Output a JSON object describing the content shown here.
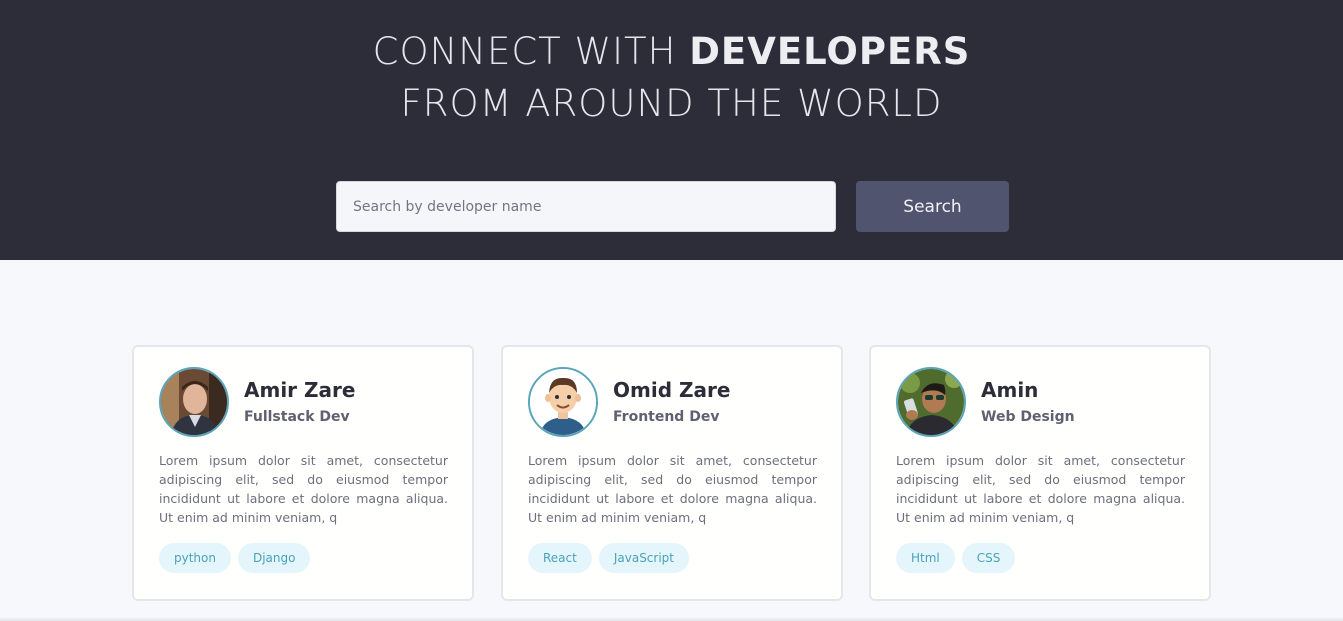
{
  "hero": {
    "title_part1": "CONNECT WITH ",
    "title_bold": "DEVELOPERS",
    "title_line2": "FROM AROUND THE WORLD"
  },
  "search": {
    "placeholder": "Search by developer name",
    "value": "",
    "button_label": "Search"
  },
  "developers": [
    {
      "name": "Amir Zare",
      "role": "Fullstack Dev",
      "avatar_icon": "photo-avatar",
      "bio": "Lorem ipsum dolor sit amet, consectetur adipiscing elit, sed do eiusmod tempor incididunt ut labore et dolore magna aliqua. Ut enim ad minim veniam, q",
      "tags": [
        "python",
        "Django"
      ]
    },
    {
      "name": "Omid Zare",
      "role": "Frontend Dev",
      "avatar_icon": "cartoon-avatar",
      "bio": "Lorem ipsum dolor sit amet, consectetur adipiscing elit, sed do eiusmod tempor incididunt ut labore et dolore magna aliqua. Ut enim ad minim veniam, q",
      "tags": [
        "React",
        "JavaScript"
      ]
    },
    {
      "name": "Amin",
      "role": "Web Design",
      "avatar_icon": "photo-avatar",
      "bio": "Lorem ipsum dolor sit amet, consectetur adipiscing elit, sed do eiusmod tempor incididunt ut labore et dolore magna aliqua. Ut enim ad minim veniam, q",
      "tags": [
        "Html",
        "CSS"
      ]
    }
  ],
  "colors": {
    "hero_bg": "#2d2d39",
    "button_bg": "#51546e",
    "avatar_ring": "#5aa5b9",
    "tag_bg": "#e4f6fb",
    "tag_text": "#4aa2b8",
    "page_bg": "#f7f8fc"
  }
}
